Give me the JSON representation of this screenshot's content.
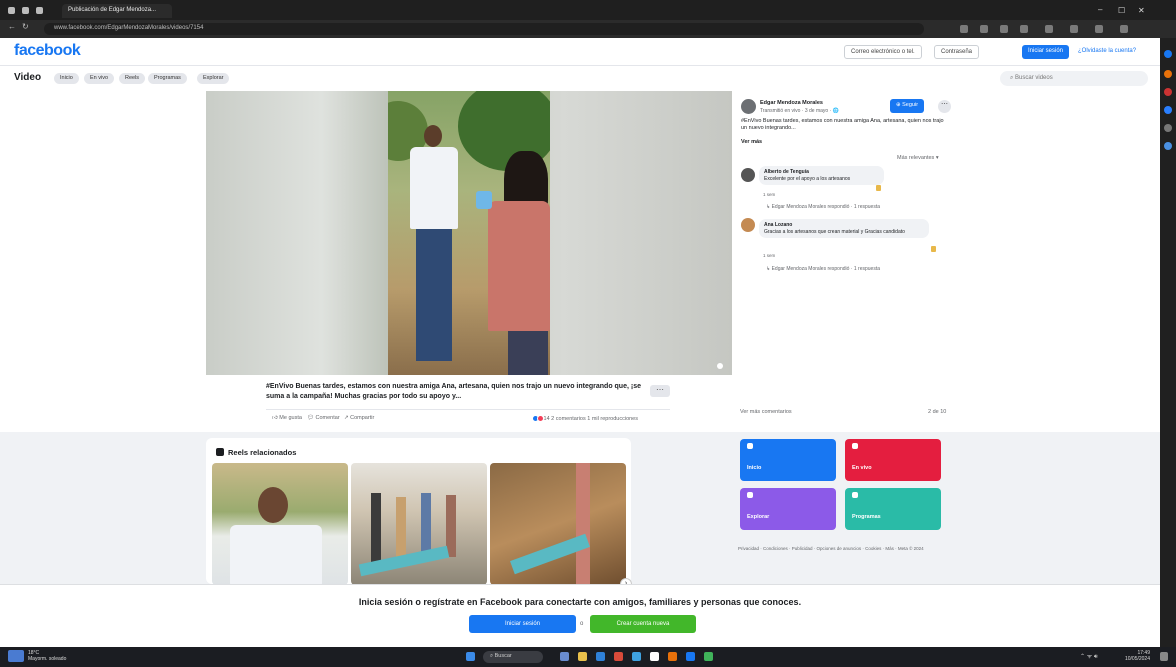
{
  "browser": {
    "tab_title": "Publicación de Edgar Mendoza...",
    "url": "www.facebook.com/EdgarMendozaMorales/videos/7154"
  },
  "header": {
    "logo": "facebook",
    "btn_contact": "Correo electrónico o tel.",
    "btn_password": "Contraseña",
    "btn_login": "Iniciar sesión",
    "link_forgot": "¿Olvidaste la cuenta?"
  },
  "subnav": {
    "title": "Video",
    "pills": [
      "Inicio",
      "En vivo",
      "Reels",
      "Programas",
      "Explorar"
    ],
    "search_placeholder": "Buscar videos"
  },
  "video": {
    "caption": "#EnVivo Buenas tardes, estamos con nuestra amiga Ana, artesana, quien nos trajo un nuevo integrando que, ¡se suma a la campaña! Muchas gracias por todo su apoyo y...",
    "actions": [
      "Me gusta",
      "Comentar",
      "Compartir"
    ],
    "stats": "14  2 comentarios  1 mil reproducciones"
  },
  "post_panel": {
    "author": "Edgar Mendoza Morales",
    "meta": "Transmitió en vivo · 3 de mayo · 🌐",
    "follow_label": "Seguir",
    "text": "#EnVivo Buenas tardes, estamos con nuestra amiga Ana, artesana, quien nos trajo un nuevo integrando...",
    "see_more": "Ver más",
    "sort_label": "Más relevantes ▾",
    "comments": [
      {
        "author": "Alberto de Tenguía",
        "text": "Excelente por el apoyo a los artesanos",
        "meta": "1 sem",
        "replies": "Edgar Mendoza Morales respondió · 1 respuesta"
      },
      {
        "author": "Ana Lozano",
        "text": "Gracias a los artesanos que crean material y Gracias candidato",
        "meta": "1 sem",
        "replies": "Edgar Mendoza Morales respondió · 1 respuesta"
      }
    ],
    "view_more": "Ver más comentarios",
    "count": "2 de 10"
  },
  "reels": {
    "title": "Reels relacionados"
  },
  "tiles": [
    {
      "label": "Inicio",
      "color": "#1877f2"
    },
    {
      "label": "En vivo",
      "color": "#e41e3f"
    },
    {
      "label": "Explorar",
      "color": "#8c5ae8"
    },
    {
      "label": "Programas",
      "color": "#2abba7"
    }
  ],
  "footer_note": "Privacidad · Condiciones · Publicidad · Opciones de anuncios · Cookies · Más · Meta © 2024",
  "banner": {
    "text": "Inicia sesión o regístrate en Facebook para conectarte con amigos, familiares y personas que conoces.",
    "login_label": "Iniciar sesión",
    "or_label": "o",
    "create_label": "Crear cuenta nueva"
  },
  "taskbar": {
    "weather_temp": "18°C",
    "weather_desc": "Mayorm. soleado",
    "search_label": "Buscar",
    "time": "17:49",
    "date": "10/05/2024"
  },
  "colors": {
    "brand": "#1877f2",
    "green": "#42b72a"
  }
}
